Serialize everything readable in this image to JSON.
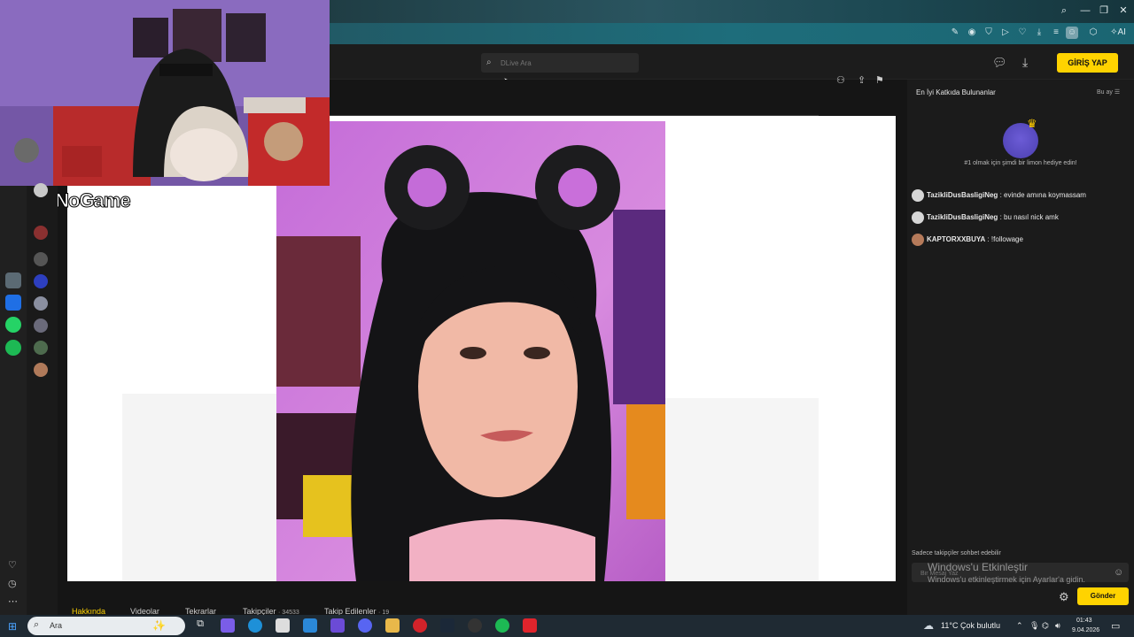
{
  "browser": {
    "window_controls": [
      "search",
      "minimize",
      "restore",
      "close"
    ],
    "toolbar_icons": [
      "edit-icon",
      "camera-icon",
      "shield-icon",
      "play-icon",
      "heart-icon",
      "download-icon",
      "menu-icon",
      "profile-icon",
      "extensions-icon",
      "ai-icon"
    ],
    "ai_label": "AI"
  },
  "site_header": {
    "search_placeholder": "DLive Ara",
    "login_label": "GİRİŞ YAP"
  },
  "overlay": {
    "logo_text": "ByNoGame"
  },
  "tabs": [
    {
      "label": "Hakkında",
      "count": ""
    },
    {
      "label": "Videolar",
      "count": ""
    },
    {
      "label": "Tekrarlar",
      "count": ""
    },
    {
      "label": "Takipçiler",
      "count": "· 34533"
    },
    {
      "label": "Takip Edilenler",
      "count": "· 19"
    }
  ],
  "chat": {
    "title": "En İyi Katkıda Bulunanlar",
    "period": "Bu ay",
    "gift_prompt": "#1 olmak için şimdi bir limon hediye edin!",
    "messages": [
      {
        "user": "TazikliDusBasligiNeg",
        "text": ": evinde amına koymassam"
      },
      {
        "user": "TazikliDusBasligiNeg",
        "text": ": bu nasıl nick amk"
      },
      {
        "user": "KAPTORXXBUYA",
        "text": ": !followage"
      }
    ],
    "followers_only": "Sadece takipçiler sohbet edebilir",
    "input_placeholder": "Bir Mesaj Yaz",
    "send_label": "Gönder",
    "windows_watermark_title": "Windows'u Etkinleştir",
    "windows_watermark_sub": "Windows'u etkinleştirmek için Ayarlar'a gidin."
  },
  "taskbar": {
    "search_label": "Ara",
    "weather": "11°C  Çok bulutlu",
    "time": "01:43",
    "date": "9.04.2026"
  },
  "colors": {
    "accent_yellow": "#ffd300",
    "page_bg": "#151515",
    "chat_bg": "#1b1b1b"
  }
}
